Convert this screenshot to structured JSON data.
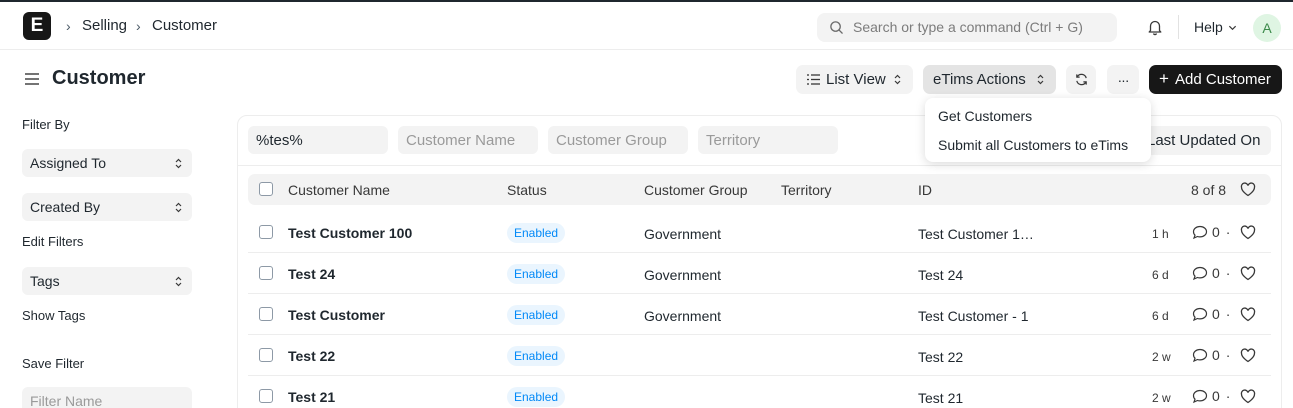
{
  "navbar": {
    "logo_letter": "E",
    "breadcrumbs": [
      "Selling",
      "Customer"
    ],
    "search_placeholder": "Search or type a command (Ctrl + G)",
    "help_label": "Help",
    "avatar_initial": "A"
  },
  "page": {
    "title": "Customer",
    "buttons": {
      "list_view": "List View",
      "etims_actions": "eTims Actions",
      "more": "···",
      "add_customer": "Add Customer"
    },
    "etims_menu": [
      "Get Customers",
      "Submit all Customers to eTims"
    ]
  },
  "sidebar": {
    "filter_by": "Filter By",
    "assigned_to": "Assigned To",
    "created_by": "Created By",
    "edit_filters": "Edit Filters",
    "tags": "Tags",
    "show_tags": "Show Tags",
    "save_filter": "Save Filter",
    "filter_name_placeholder": "Filter Name"
  },
  "filters": {
    "id_value": "%tes%",
    "customer_name_placeholder": "Customer Name",
    "customer_group_placeholder": "Customer Group",
    "territory_placeholder": "Territory",
    "sort_label": "Last Updated On"
  },
  "table": {
    "columns": [
      "Customer Name",
      "Status",
      "Customer Group",
      "Territory",
      "ID"
    ],
    "count": "8 of 8",
    "rows": [
      {
        "name": "Test Customer 100",
        "status": "Enabled",
        "group": "Government",
        "territory": "",
        "id": "Test Customer 1…",
        "time": "1 h",
        "comments": "0"
      },
      {
        "name": "Test 24",
        "status": "Enabled",
        "group": "Government",
        "territory": "",
        "id": "Test 24",
        "time": "6 d",
        "comments": "0"
      },
      {
        "name": "Test Customer",
        "status": "Enabled",
        "group": "Government",
        "territory": "",
        "id": "Test Customer - 1",
        "time": "6 d",
        "comments": "0"
      },
      {
        "name": "Test 22",
        "status": "Enabled",
        "group": "",
        "territory": "",
        "id": "Test 22",
        "time": "2 w",
        "comments": "0"
      },
      {
        "name": "Test 21",
        "status": "Enabled",
        "group": "",
        "territory": "",
        "id": "Test 21",
        "time": "2 w",
        "comments": "0"
      }
    ]
  },
  "colors": {
    "accent_dark": "#171717",
    "badge_blue": "#0289f7",
    "badge_bg": "#eaf5fe"
  }
}
